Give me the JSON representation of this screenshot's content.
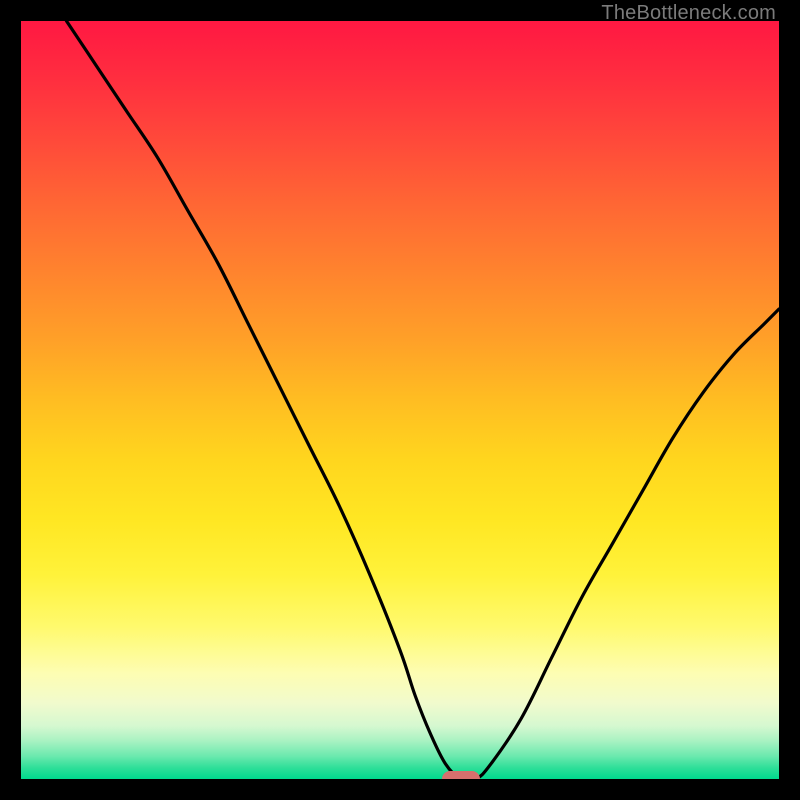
{
  "watermark": "TheBottleneck.com",
  "colors": {
    "marker_fill": "#d6706d",
    "curve_stroke": "#000000",
    "frame": "#000000"
  },
  "chart_data": {
    "type": "line",
    "title": "",
    "xlabel": "",
    "ylabel": "",
    "xlim": [
      0,
      100
    ],
    "ylim": [
      0,
      100
    ],
    "grid": false,
    "legend_position": "none",
    "series": [
      {
        "name": "bottleneck-curve",
        "x": [
          6,
          10,
          14,
          18,
          22,
          26,
          30,
          34,
          38,
          42,
          46,
          50,
          52,
          54,
          56,
          58,
          60,
          62,
          66,
          70,
          74,
          78,
          82,
          86,
          90,
          94,
          98,
          100
        ],
        "y": [
          100,
          94,
          88,
          82,
          75,
          68,
          60,
          52,
          44,
          36,
          27,
          17,
          11,
          6,
          2,
          0,
          0,
          2,
          8,
          16,
          24,
          31,
          38,
          45,
          51,
          56,
          60,
          62
        ]
      }
    ],
    "annotations": [
      {
        "name": "optimal-marker",
        "x": 58,
        "y": 0,
        "shape": "pill",
        "color": "#d6706d"
      }
    ],
    "background": {
      "type": "vertical-gradient-red-yellow-green",
      "meaning": "red=high bottleneck, green=no bottleneck"
    }
  }
}
